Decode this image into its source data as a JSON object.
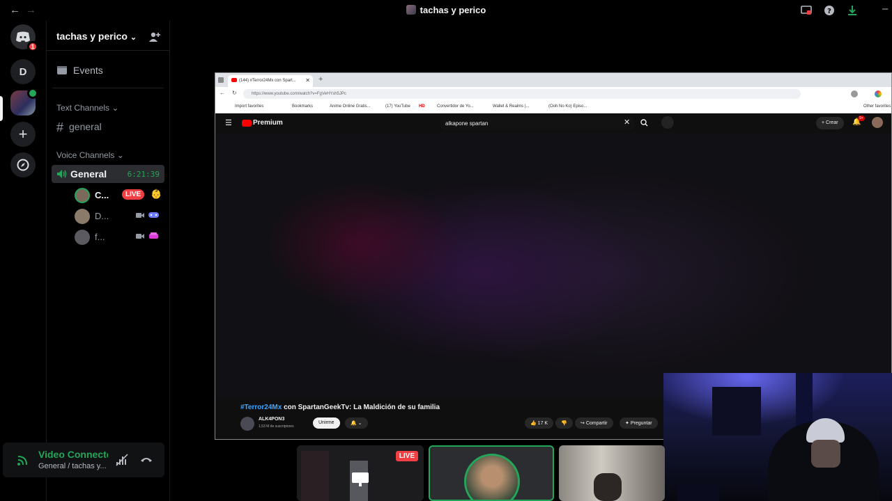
{
  "window": {
    "title": "tachas y perico"
  },
  "guilds": {
    "home_badge": "1",
    "server_d": "D"
  },
  "server": {
    "name": "tachas y perico",
    "events_label": "Events"
  },
  "text_channels": {
    "category": "Text Channels",
    "items": [
      {
        "name": "general"
      }
    ]
  },
  "voice_channels": {
    "category": "Voice Channels",
    "active": {
      "name": "General",
      "timer": "6:21:39"
    },
    "members": [
      {
        "name": "C...",
        "live": "LIVE"
      },
      {
        "name": "D..."
      },
      {
        "name": "f..."
      }
    ]
  },
  "voice_panel": {
    "status": "Video Connected",
    "location": "General / tachas y..."
  },
  "browser": {
    "tab_title": "(144) #Terror24Mx con Spart...",
    "url": "https://www.youtube.com/watch?v=FgVeHYsh5JPc",
    "bookmarks": [
      "Import favorites",
      "Bookmarks",
      "Anime Online Gratis...",
      "(17) YouTube",
      "HD",
      "Convertidor de Yo...",
      "Wallet & Realms |...",
      "(Ooh No Ko) Episo...",
      "Other favorites"
    ]
  },
  "youtube": {
    "logo": "Premium",
    "search_value": "alkapone spartan",
    "create_label": "Crear",
    "notif_count": "9+",
    "video_hashtag": "#Terror24Mx",
    "video_title": " con SpartanGeekTv: La Maldición de su familia",
    "channel_name": "ALK4PON3",
    "subscribers": "1,53 M de suscriptores",
    "join_label": "Unirme",
    "likes": "17 K",
    "share_label": "Compartir",
    "ask_label": "Preguntar"
  },
  "stream_tiles": {
    "live": "LIVE"
  },
  "colors": {
    "accent_green": "#23a55a",
    "live_red": "#f23f43",
    "link_blue": "#3ea6ff"
  }
}
